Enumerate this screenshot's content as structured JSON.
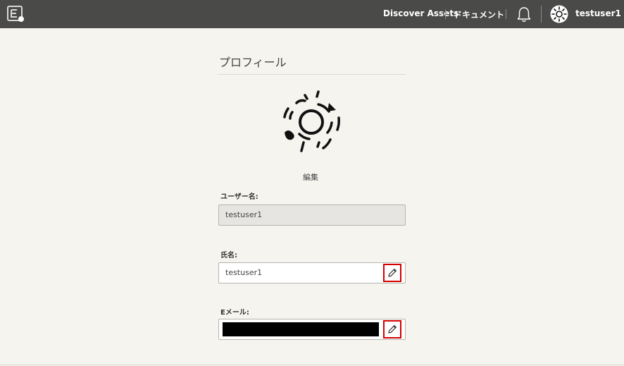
{
  "header": {
    "discover_assets_label": "Discover Assets",
    "documents_label": "ドキュメント",
    "username": "testuser1",
    "icons": {
      "logo": "app-logo-icon",
      "notifications": "bell-icon",
      "avatar": "user-avatar-icon",
      "menu_caret": "caret-down-icon"
    }
  },
  "profile": {
    "title": "プロフィール",
    "edit_label": "編集",
    "fields": {
      "username": {
        "label": "ユーザー名:",
        "value": "testuser1",
        "readonly": true
      },
      "full_name": {
        "label": "氏名:",
        "value": "testuser1",
        "edit_icon": "pencil-icon"
      },
      "email": {
        "label": "Eメール:",
        "value_redacted": true,
        "edit_icon": "pencil-icon"
      }
    }
  },
  "colors": {
    "topbar_bg": "#4a4a48",
    "page_bg": "#f5f4ef",
    "highlight_border": "#d40000"
  }
}
